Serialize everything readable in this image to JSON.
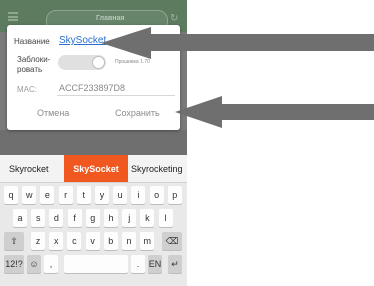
{
  "appbar": {
    "tab_active": "Главная"
  },
  "dialog": {
    "name_label": "Название",
    "name_value": "SkySocket",
    "lock_label_1": "Заблоки-",
    "lock_label_2": "ровать",
    "firmware_text": "Прошивка 1.70",
    "mac_label": "MAC:",
    "mac_value": "ACCF233897D8",
    "cancel_label": "Отмена",
    "save_label": "Сохранить",
    "lock_toggle_state": "on"
  },
  "keyboard": {
    "suggestions": [
      "Skyrocket",
      "SkySocket",
      "Skyrocketing"
    ],
    "row1": [
      "q",
      "w",
      "e",
      "r",
      "t",
      "y",
      "u",
      "i",
      "o",
      "p"
    ],
    "row2": [
      "a",
      "s",
      "d",
      "f",
      "g",
      "h",
      "j",
      "k",
      "l"
    ],
    "row3": [
      "z",
      "x",
      "c",
      "v",
      "b",
      "n",
      "m"
    ],
    "sym_label": "12!?",
    "emoji_label": "☺",
    "comma_label": ",",
    "period_label": ".",
    "lang_label": "EN",
    "enter_label": "↵",
    "shift_label": "⇧",
    "backspace_label": "⌫"
  },
  "arrows": {
    "color": "#6f6f6f",
    "targets": [
      "name-field",
      "save-button"
    ]
  }
}
